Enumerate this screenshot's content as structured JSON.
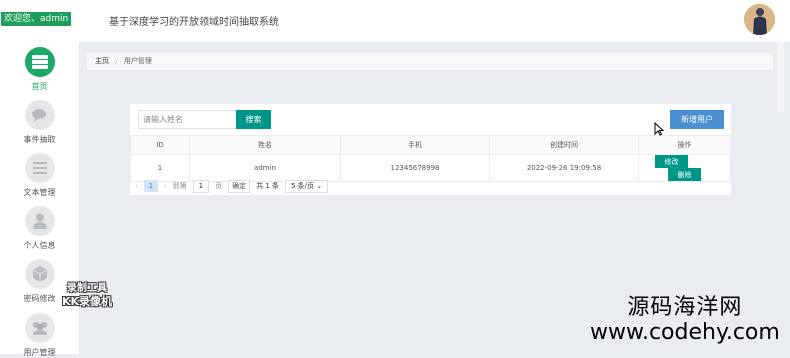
{
  "sidebar": {
    "welcome": "欢迎您、admin",
    "items": [
      {
        "label": "首页",
        "icon": "server-icon",
        "active": true
      },
      {
        "label": "事件抽取",
        "icon": "chat-icon",
        "active": false
      },
      {
        "label": "文本管理",
        "icon": "list-icon",
        "active": false
      },
      {
        "label": "个人信息",
        "icon": "user-icon",
        "active": false
      },
      {
        "label": "密码修改",
        "icon": "cube-icon",
        "active": false
      },
      {
        "label": "用户管理",
        "icon": "users-icon",
        "active": false
      }
    ]
  },
  "header": {
    "title": "基于深度学习的开放领域时间抽取系统"
  },
  "breadcrumb": {
    "home": "主页",
    "separator": "/",
    "current": "用户管理"
  },
  "toolbar": {
    "search_placeholder": "请输入姓名",
    "search_value": "",
    "search_label": "搜索",
    "add_label": "新增用户"
  },
  "table": {
    "columns": [
      "ID",
      "姓名",
      "手机",
      "创建时间",
      "操作"
    ],
    "rows": [
      {
        "id": "1",
        "name": "admin",
        "phone": "12345678998",
        "created": "2022-09-26 19:09:58",
        "edit_label": "修改",
        "delete_label": "删除"
      }
    ]
  },
  "pager": {
    "prev": "‹",
    "current_page": "1",
    "next": "›",
    "goto_label": "到第",
    "goto_value": "1",
    "page_unit": "页",
    "confirm_label": "确定",
    "total_label": "共 1 条",
    "page_size": "5 条/页"
  },
  "watermarks": {
    "kk_line1": "录制工具",
    "kk_line2": "KK录像机",
    "site_line1": "源码海洋网",
    "site_line2": "www.codehy.com"
  },
  "colors": {
    "accent_green": "#1aa866",
    "teal_button": "#009688",
    "blue_button": "#4a8fce"
  }
}
